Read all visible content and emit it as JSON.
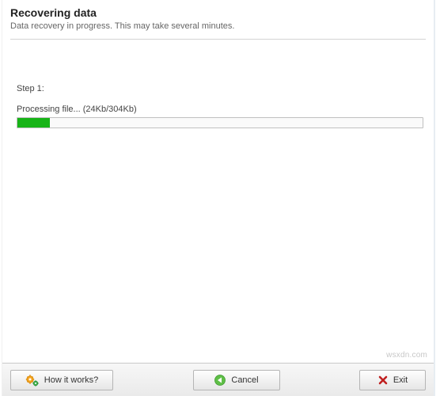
{
  "header": {
    "title": "Recovering data",
    "subtitle": "Data recovery in progress. This may take several minutes."
  },
  "content": {
    "step_label": "Step 1:",
    "processing_label": "Processing file... (24Kb/304Kb)",
    "progress_percent": 8
  },
  "footer": {
    "how_label": "How it works?",
    "cancel_label": "Cancel",
    "exit_label": "Exit"
  },
  "watermark": "wsxdn.com"
}
